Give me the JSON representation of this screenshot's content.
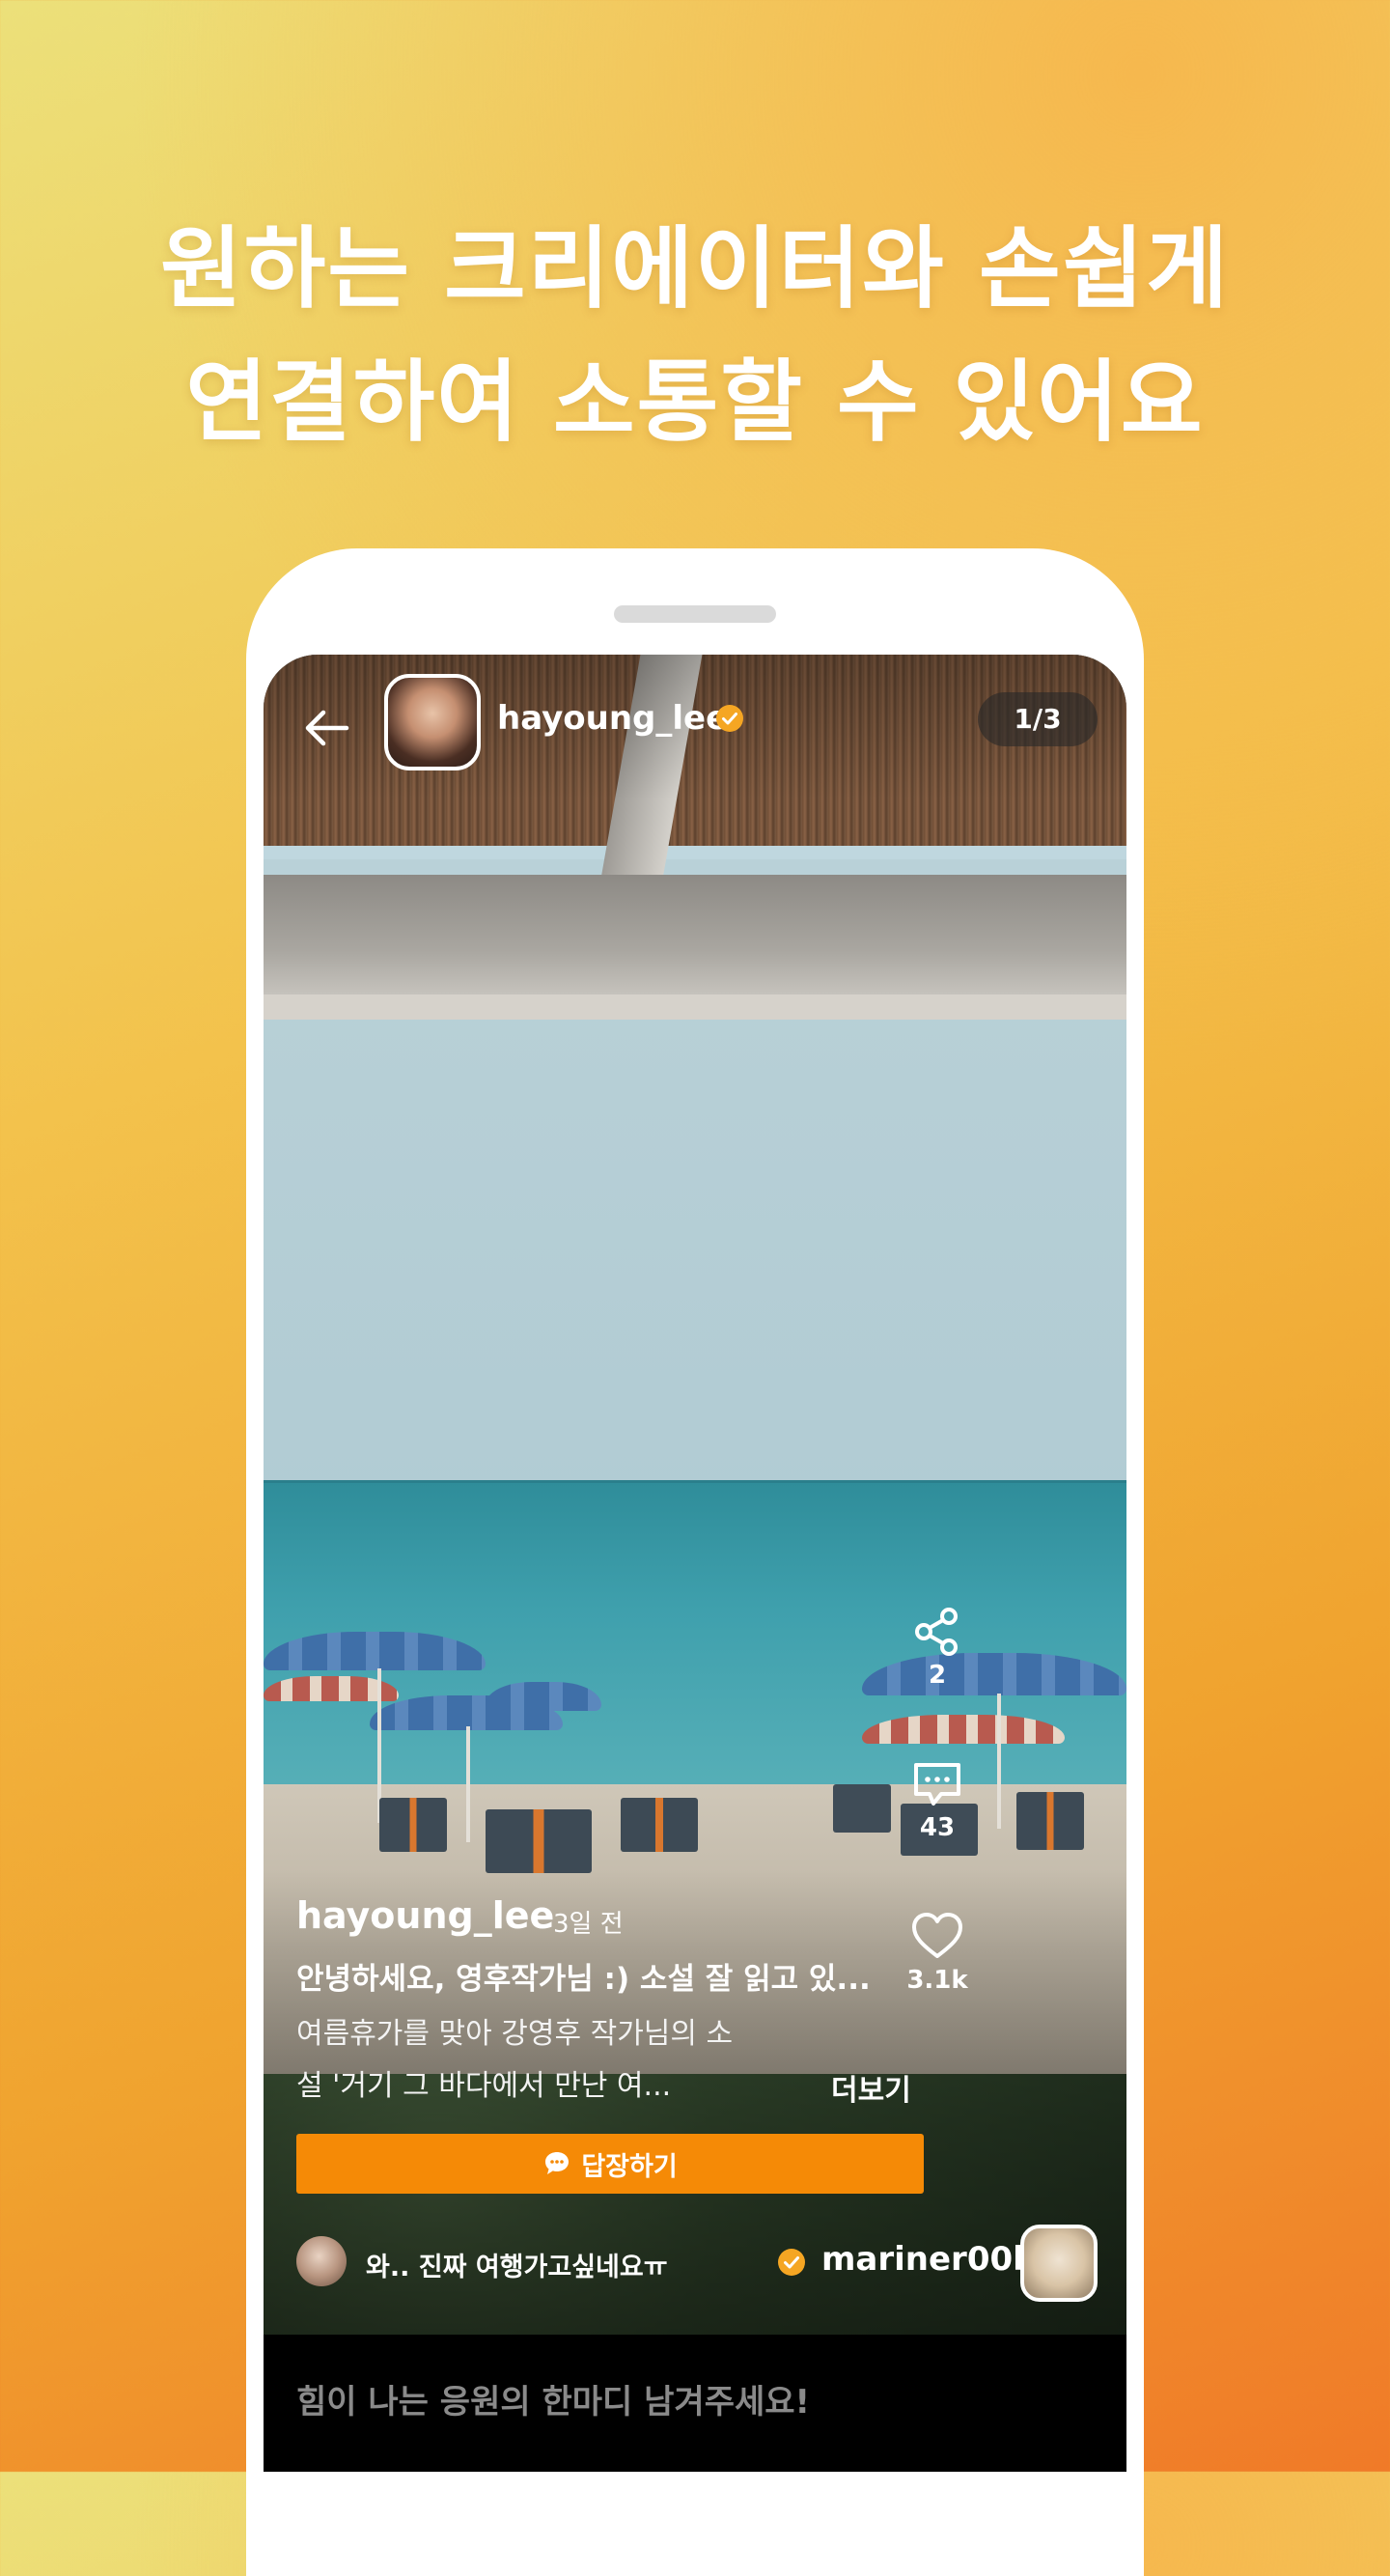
{
  "headline": {
    "line1": "원하는 크리에이터와 손쉽게",
    "line2": "연결하여 소통할 수 있어요"
  },
  "post": {
    "username": "hayoung_lee",
    "page_counter": "1/3",
    "time_ago": "3일 전",
    "title": "안녕하세요, 영후작가님 :) 소설 잘 읽고 있...",
    "body_line1": "여름휴가를 맞아 강영후 작가님의  소",
    "body_line2": "설 '거기 그 바다에서 만난 여...",
    "more_label": "더보기"
  },
  "actions": {
    "share_count": "2",
    "comment_count": "43",
    "like_count": "3.1k"
  },
  "reply_button_label": "답장하기",
  "comment": {
    "text": "와.. 진짜 여행가고싶네요ㅠ",
    "username": "mariner00b"
  },
  "input": {
    "placeholder": "힘이 나는 응원의 한마디 남겨주세요!"
  },
  "colors": {
    "accent": "#f58a06",
    "verified": "#f5a623"
  },
  "icons": {
    "back": "arrow-left-icon",
    "verified": "verified-badge-icon",
    "share": "share-icon",
    "comment": "comment-icon",
    "like": "heart-icon",
    "reply": "chat-bubble-icon"
  }
}
